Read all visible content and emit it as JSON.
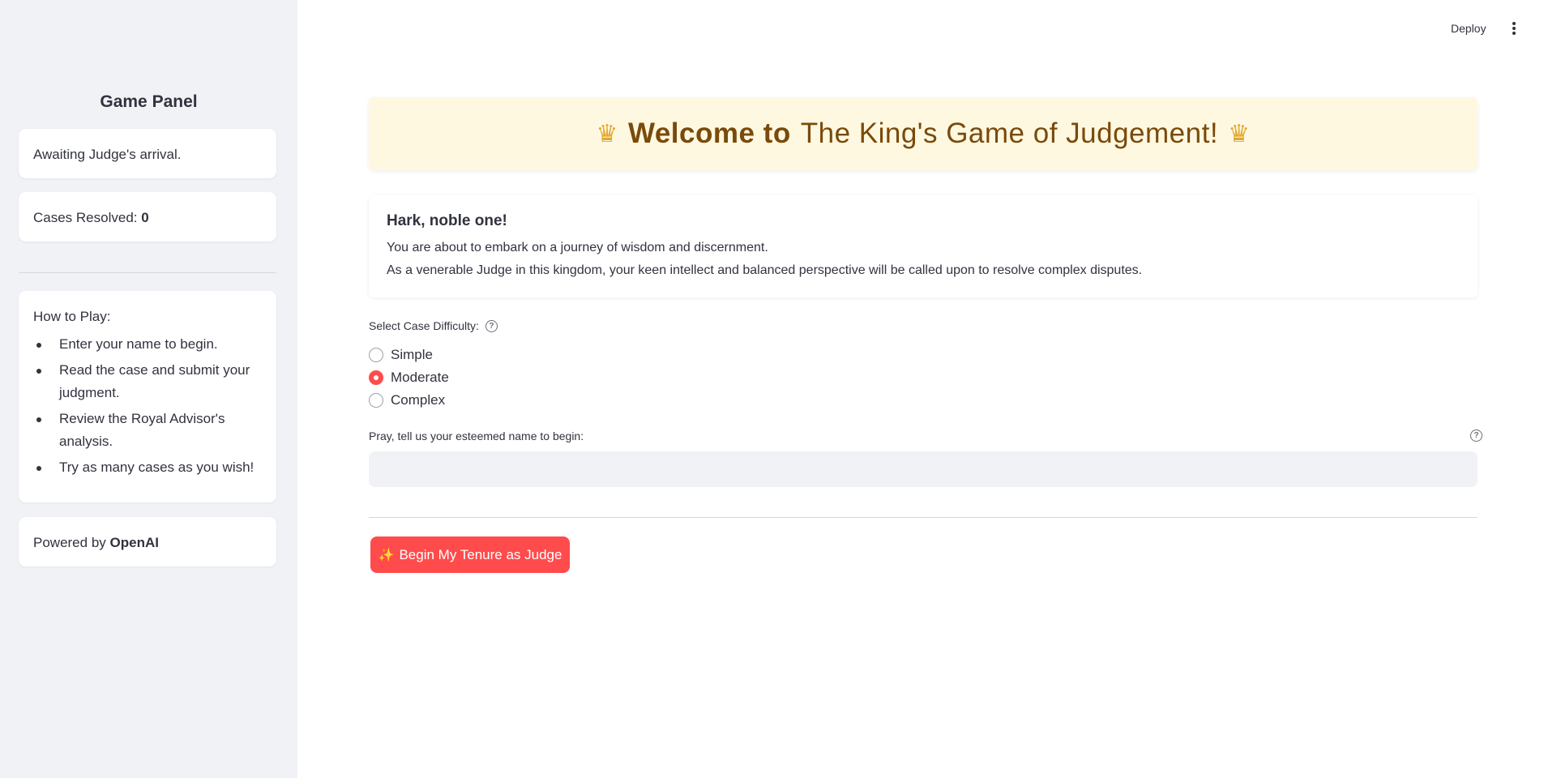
{
  "header": {
    "deploy_label": "Deploy",
    "menu_icon": "kebab-menu-icon"
  },
  "sidebar": {
    "title": "Game Panel",
    "status_text": "Awaiting Judge's arrival.",
    "cases_label": "Cases Resolved:",
    "cases_count": "0",
    "how_to_title": "How to Play:",
    "how_to_items": [
      "Enter your name to begin.",
      "Read the case and submit your judgment.",
      "Review the Royal Advisor's analysis.",
      "Try as many cases as you wish!"
    ],
    "powered_label": "Powered by",
    "powered_brand": "OpenAI"
  },
  "main": {
    "banner": {
      "prefix": "Welcome to",
      "title": "The King's Game of Judgement!",
      "icon": "crown-icon"
    },
    "intro": {
      "heading": "Hark, noble one!",
      "line1": "You are about to embark on a journey of wisdom and discernment.",
      "line2": "As a venerable Judge in this kingdom, your keen intellect and balanced perspective will be called upon to resolve complex disputes."
    },
    "difficulty": {
      "label": "Select Case Difficulty:",
      "options": [
        "Simple",
        "Moderate",
        "Complex"
      ],
      "selected": "Moderate"
    },
    "name_field": {
      "label": "Pray, tell us your esteemed name to begin:",
      "value": "",
      "placeholder": ""
    },
    "begin_button": {
      "label": "Begin My Tenure as Judge",
      "icon": "sparkles-icon"
    }
  },
  "colors": {
    "accent": "#ff4b4b",
    "banner_bg": "#fff8e1",
    "banner_text": "#7a4a0b",
    "sidebar_bg": "#f0f2f6"
  }
}
